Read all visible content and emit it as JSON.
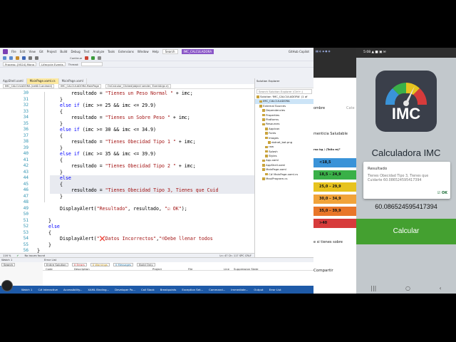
{
  "vs": {
    "menu": [
      "File",
      "Edit",
      "View",
      "Git",
      "Project",
      "Build",
      "Debug",
      "Test",
      "Analyze",
      "Tools",
      "Extensions",
      "Window",
      "Help"
    ],
    "search": "Search",
    "project_badge": "IMC_CALCULADORA",
    "copilot": "GitHub Copilot",
    "process": "Process: [9524] Mono",
    "lifecycle": "Lifecycle Events",
    "thread": "Thread:",
    "continue": "Continue",
    "tabs": [
      "AppShell.xaml",
      "MainPage.xaml.cs",
      "MainPage.xaml"
    ],
    "nav": {
      "project": "IMC_CALCULADORA (net8.0-android)",
      "class": "IMC_CALCULADORA.MainPage",
      "method": "OnCalcular_Clicked(object sender, EventArgs e)"
    },
    "status": {
      "zoom": "116 %",
      "issues": "No issues found",
      "pos": "Ln: 47  Ch: 117  SPC  CRLF"
    }
  },
  "code_lines": [
    {
      "n": "30",
      "indent": 96,
      "parts": [
        [
          "",
          "resultado = "
        ],
        [
          "str",
          "\"Tienes un Peso Normal \""
        ],
        [
          "",
          " + imc;"
        ]
      ]
    },
    {
      "n": "31",
      "indent": 80,
      "parts": [
        [
          "",
          "}"
        ]
      ]
    },
    {
      "n": "32",
      "indent": 80,
      "parts": [
        [
          "kw",
          "else if"
        ],
        [
          "",
          " (imc >= 25 && imc <= 29.9)"
        ]
      ]
    },
    {
      "n": "33",
      "indent": 80,
      "parts": [
        [
          "",
          "{"
        ]
      ]
    },
    {
      "n": "34",
      "indent": 96,
      "parts": [
        [
          "",
          "resultado = "
        ],
        [
          "str",
          "\"Tienes un Sobre Peso \""
        ],
        [
          "",
          " + imc;"
        ]
      ]
    },
    {
      "n": "35",
      "indent": 80,
      "parts": [
        [
          "",
          "}"
        ]
      ]
    },
    {
      "n": "36",
      "indent": 80,
      "parts": [
        [
          "kw",
          "else if"
        ],
        [
          "",
          " (imc >= 30 && imc <= 34.9)"
        ]
      ]
    },
    {
      "n": "37",
      "indent": 80,
      "parts": [
        [
          "",
          "{"
        ]
      ]
    },
    {
      "n": "38",
      "indent": 96,
      "parts": [
        [
          "",
          "resultado = "
        ],
        [
          "str",
          "\"Tienes Obecidad Tipo 1 \""
        ],
        [
          "",
          " + imc;"
        ]
      ]
    },
    {
      "n": "39",
      "indent": 80,
      "parts": [
        [
          "",
          "}"
        ]
      ]
    },
    {
      "n": "40",
      "indent": 80,
      "parts": [
        [
          "kw",
          "else if"
        ],
        [
          "",
          " (imc >= 35 && imc <= 39.9)"
        ]
      ]
    },
    {
      "n": "41",
      "indent": 80,
      "parts": [
        [
          "",
          "{"
        ]
      ]
    },
    {
      "n": "42",
      "indent": 96,
      "parts": [
        [
          "",
          "resultado = "
        ],
        [
          "str",
          "\"Tienes Obecidad Tipo 2 \""
        ],
        [
          "",
          " + imc;"
        ]
      ]
    },
    {
      "n": "43",
      "indent": 80,
      "parts": [
        [
          "",
          "}"
        ]
      ]
    },
    {
      "n": "44",
      "indent": 80,
      "parts": [
        [
          "kw",
          "else"
        ]
      ]
    },
    {
      "n": "45",
      "indent": 80,
      "parts": [
        [
          "",
          "{"
        ]
      ]
    },
    {
      "n": "46",
      "indent": 96,
      "parts": [
        [
          "",
          "resultado = "
        ],
        [
          "str",
          "\"Tienes Obecidad Tipo 3, Tienes que Cuid"
        ]
      ]
    },
    {
      "n": "47",
      "indent": 80,
      "parts": [
        [
          "",
          "}"
        ]
      ]
    },
    {
      "n": "48",
      "indent": 80,
      "parts": [
        [
          "",
          ""
        ]
      ]
    },
    {
      "n": "49",
      "indent": 80,
      "parts": [
        [
          "",
          "DisplayAlert("
        ],
        [
          "str",
          "\"Resultado\""
        ],
        [
          "",
          ", resultado, "
        ],
        [
          "str",
          "\"☑ OK\""
        ],
        [
          "",
          ");"
        ]
      ]
    },
    {
      "n": "50",
      "indent": 80,
      "parts": [
        [
          "",
          ""
        ]
      ]
    },
    {
      "n": "51",
      "indent": 64,
      "parts": [
        [
          "",
          "}"
        ]
      ]
    },
    {
      "n": "52",
      "indent": 64,
      "parts": [
        [
          "kw",
          "else"
        ]
      ]
    },
    {
      "n": "53",
      "indent": 64,
      "parts": [
        [
          "",
          "{"
        ]
      ]
    },
    {
      "n": "54",
      "indent": 80,
      "parts": [
        [
          "",
          "DisplayAlert("
        ],
        [
          "str",
          "\"❌Datos Incorrectos\""
        ],
        [
          "",
          ","
        ],
        [
          "str",
          "\"☹Debe llenar todos"
        ]
      ]
    },
    {
      "n": "55",
      "indent": 64,
      "parts": [
        [
          "",
          "}"
        ]
      ]
    },
    {
      "n": "56",
      "indent": 48,
      "parts": [
        [
          "",
          "}"
        ]
      ]
    }
  ],
  "solution": {
    "title": "Solution Explorer",
    "search": "Search Solution Explorer (Ctrl+;)",
    "items": [
      {
        "label": "Solution 'IMC_CALCULADORA' (1 of",
        "d": 0
      },
      {
        "label": "IMC_CALCULADORA",
        "d": 1
      },
      {
        "label": "External Sources",
        "d": 1
      },
      {
        "label": "Dependencies",
        "d": 2
      },
      {
        "label": "Properties",
        "d": 2
      },
      {
        "label": "Platforms",
        "d": 2
      },
      {
        "label": "Resources",
        "d": 2
      },
      {
        "label": "AppIcon",
        "d": 3
      },
      {
        "label": "Fonts",
        "d": 3
      },
      {
        "label": "Images",
        "d": 3
      },
      {
        "label": "dotnet_bot.png",
        "d": 4
      },
      {
        "label": "raw",
        "d": 3
      },
      {
        "label": "Splash",
        "d": 3
      },
      {
        "label": "Styles",
        "d": 3
      },
      {
        "label": "App.xaml",
        "d": 2
      },
      {
        "label": "AppShell.xaml",
        "d": 2
      },
      {
        "label": "MainPage.xaml",
        "d": 2
      },
      {
        "label": "C# MainPage.xaml.cs",
        "d": 3
      },
      {
        "label": "MauiProgram.cs",
        "d": 2
      }
    ]
  },
  "watch": {
    "title": "Watch 1",
    "search": "Search"
  },
  "errors": {
    "title": "Error List",
    "scope": "Entire Solution",
    "errors": "0 Errors",
    "warnings": "0 Warnings",
    "messages": "0 Messages",
    "build": "Build Only",
    "cols": [
      "Code",
      "Description",
      "Project",
      "File",
      "Line",
      "Suppression State"
    ]
  },
  "bottom_tabs": [
    "Watch 1",
    "C# Interactive",
    "Accessibility...",
    "XAML Binding...",
    "Developer Po...",
    "Call Stack",
    "Breakpoints",
    "Exception Set...",
    "Command...",
    "Immediate...",
    "Output",
    "Error List"
  ],
  "browser": {
    "labels": [
      "ombre",
      "Cate"
    ],
    "heading": "menticia Saludable",
    "col_header": "rso kg / (Talla m)²",
    "bands": [
      {
        "range": "<18,5",
        "color": "#3a93d8"
      },
      {
        "range": "18,5 – 24,9",
        "color": "#3ab048"
      },
      {
        "range": "25,0 – 29,9",
        "color": "#e7c31f"
      },
      {
        "range": "30,0 – 34,9",
        "color": "#f1a33a"
      },
      {
        "range": "35,0 – 39,9",
        "color": "#e8762a"
      },
      {
        "range": ">40",
        "color": "#d73b3b"
      }
    ],
    "q": "e si tienes sobre",
    "share": "Compartir"
  },
  "phone": {
    "status": "5:08 ▲ ■ ▣ ✉",
    "logo_text": "IMC",
    "app_title": "Calculadora IMC",
    "dialog_title": "Resultado",
    "dialog_msg": "Tienes Obecidad Tipo 3, Tienes que Cuidarte 60.086524595417394",
    "dialog_ok": "☑ OK",
    "result": "60.086524595417394",
    "button": "Calcular"
  },
  "colors": {
    "vs_purple": "#7b3fb4",
    "calc_green": "#44a030",
    "taskbar_blue": "#1e5aa8"
  }
}
